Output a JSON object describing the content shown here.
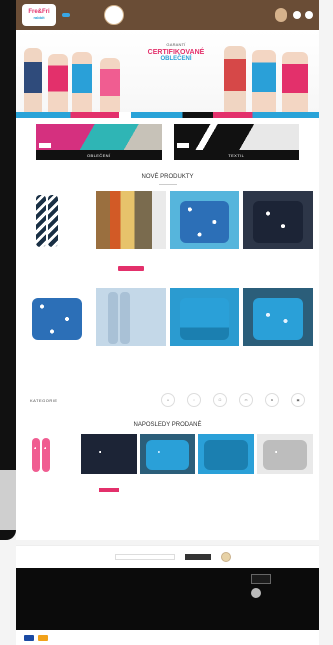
{
  "nav": {
    "logo_top": "Fre&Fri",
    "logo_sub": "rabbit",
    "items": [
      "",
      "",
      ""
    ],
    "badge_text": "",
    "cart_label": ""
  },
  "hero": {
    "kicker": "GARANTÍ",
    "title": "CERTIFIKOVANÉ",
    "subtitle": "OBLEČENÍ"
  },
  "banners": [
    {
      "label": "OBLEČENÍ",
      "tag": ""
    },
    {
      "label": "TEXTIL",
      "tag": ""
    }
  ],
  "section_new": {
    "title": "NOVÉ PRODUKTY",
    "tab_on": "",
    "tab_off": ""
  },
  "products": [
    {
      "name": "",
      "price": ""
    },
    {
      "name": "",
      "price": ""
    },
    {
      "name": "",
      "price": ""
    },
    {
      "name": "",
      "price": ""
    },
    {
      "name": "",
      "price": ""
    },
    {
      "name": "",
      "price": ""
    },
    {
      "name": "",
      "price": ""
    },
    {
      "name": "",
      "price": ""
    }
  ],
  "categories": {
    "title": "KATEGORIE",
    "items": [
      "",
      "",
      "",
      "",
      "",
      ""
    ]
  },
  "section_sale": {
    "title": "NAPOSLEDY PRODANÉ"
  },
  "sale_products": [
    {
      "name": "",
      "price": ""
    },
    {
      "name": "",
      "price": ""
    },
    {
      "name": "",
      "price": ""
    },
    {
      "name": "",
      "price": ""
    },
    {
      "name": "",
      "price": ""
    }
  ],
  "newsletter": {
    "text": "",
    "placeholder": "",
    "button": ""
  },
  "footer": {
    "cols": [
      {
        "head": "",
        "links": [
          "",
          "",
          "",
          "",
          "",
          ""
        ]
      },
      {
        "head": "",
        "links": [
          "",
          "",
          "",
          "",
          ""
        ]
      },
      {
        "head": "",
        "links": [
          "",
          "",
          "",
          "",
          ""
        ]
      },
      {
        "head": "",
        "links": [
          "",
          "",
          "",
          "",
          ""
        ]
      },
      {
        "head": "",
        "links": [
          "",
          "",
          "",
          ""
        ]
      }
    ],
    "copyright": ""
  },
  "colors": {
    "brand_brown": "#6a4d36",
    "accent_blue": "#2aa0d8",
    "accent_pink": "#e3306b"
  }
}
